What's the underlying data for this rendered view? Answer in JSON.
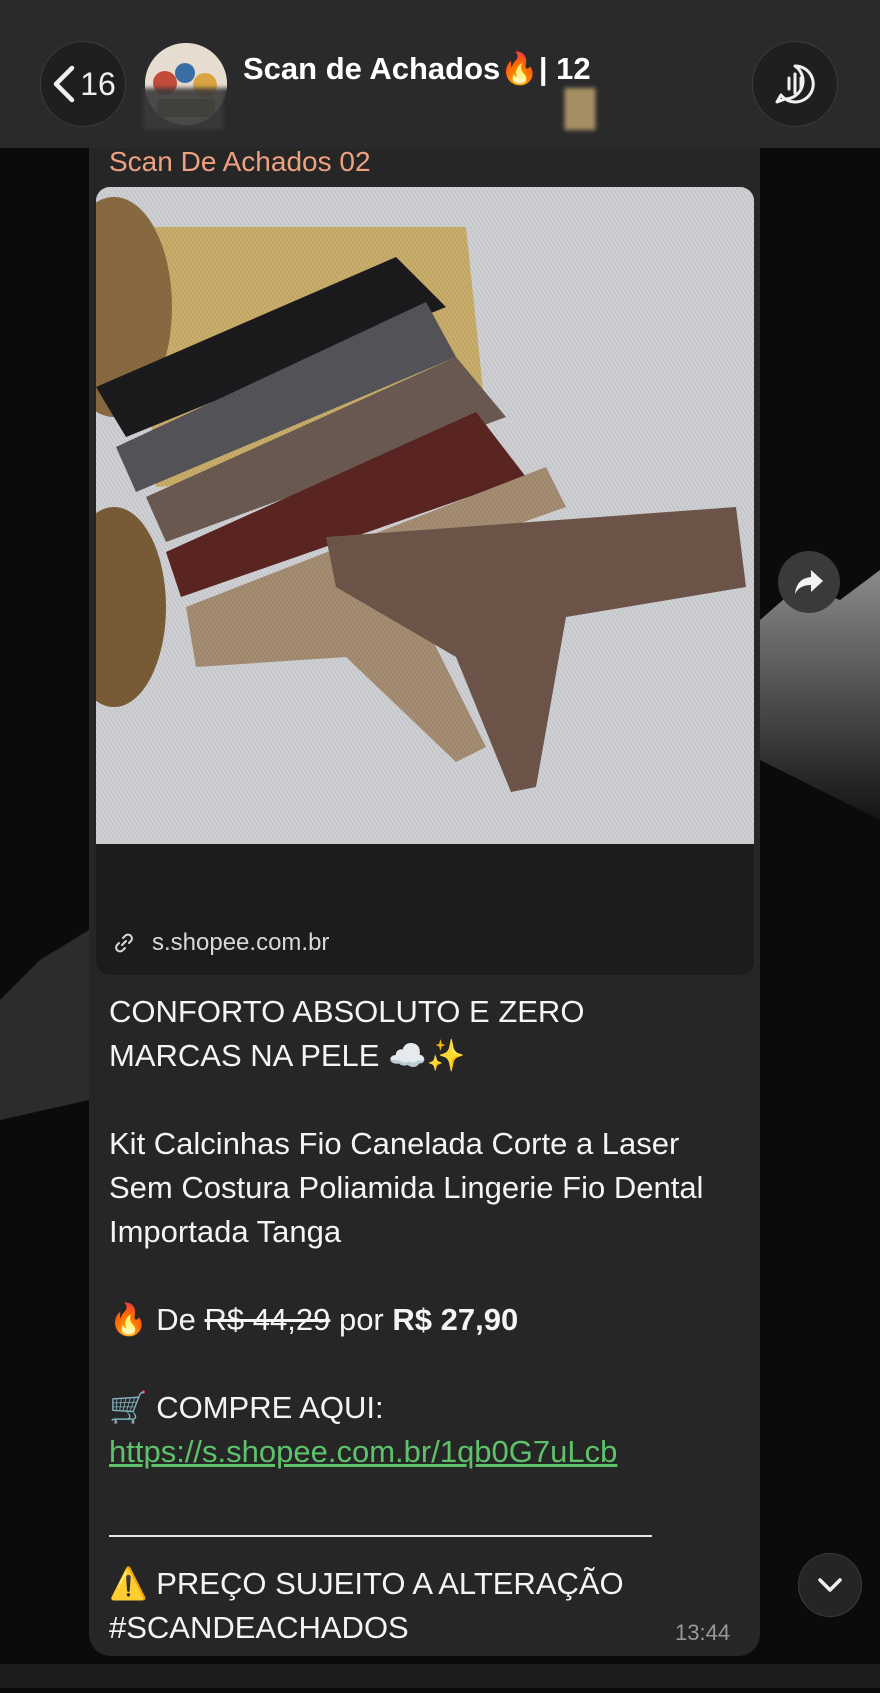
{
  "header": {
    "back_count": "16",
    "title": "Scan de Achados🔥| 12"
  },
  "message": {
    "sender": "Scan De Achados 02",
    "link_domain": "s.shopee.com.br",
    "headline_line1": "CONFORTO ABSOLUTO E ZERO",
    "headline_line2": "MARCAS NA PELE ☁️✨",
    "product": "Kit Calcinhas Fio Canelada Corte a Laser Sem Costura Poliamida Lingerie Fio Dental Importada Tanga",
    "price_emoji": "🔥",
    "price_prefix": "De",
    "price_old": "R$ 44,29",
    "price_mid": "por",
    "price_new": "R$ 27,90",
    "cta_emoji": "🛒",
    "cta": "COMPRE AQUI:",
    "url": "https://s.shopee.com.br/1qb0G7uLcb",
    "warning_emoji": "⚠️",
    "warning": "PREÇO SUJEITO A ALTERAÇÃO",
    "hashtag": "#SCANDEACHADOS",
    "time": "13:44"
  },
  "icons": {
    "back": "chevron-left-icon",
    "call": "voice-chat-icon",
    "share": "share-forward-icon",
    "scroll": "chevron-down-icon",
    "link": "link-icon"
  },
  "colors": {
    "sender": "#eea17f",
    "link": "#5ec26a",
    "bubble": "#262627",
    "header": "#2a2a2c"
  }
}
